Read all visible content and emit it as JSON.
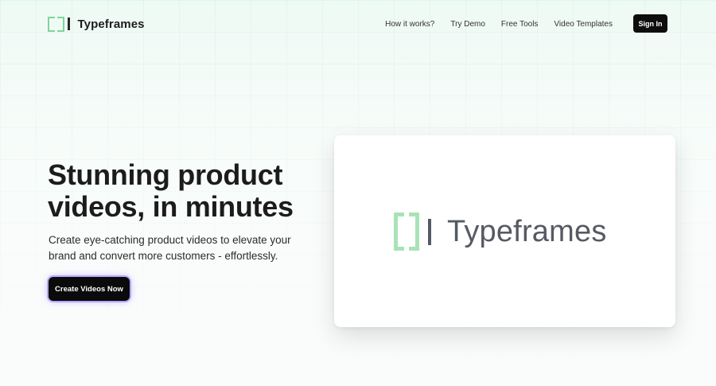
{
  "header": {
    "brand": "Typeframes",
    "nav": [
      {
        "label": "How it works?"
      },
      {
        "label": "Try Demo"
      },
      {
        "label": "Free Tools"
      },
      {
        "label": "Video Templates"
      }
    ],
    "signin_label": "Sign In"
  },
  "hero": {
    "title_line1": "Stunning product",
    "title_line2": "videos, in minutes",
    "subtitle": "Create eye-catching product videos to elevate your brand and convert more customers - effortlessly.",
    "cta_label": "Create Videos Now"
  },
  "preview": {
    "brand": "Typeframes"
  },
  "colors": {
    "accent_green": "#7ed69a",
    "preview_green": "#a8e3b8",
    "cta_glow": "#9678ff",
    "text_dark": "#1c1c1e"
  }
}
